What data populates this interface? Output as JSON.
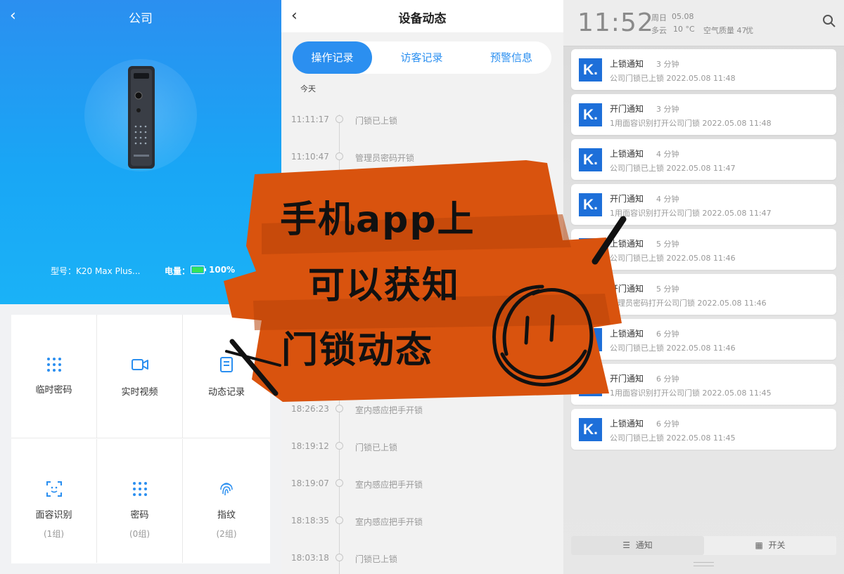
{
  "panel_home": {
    "title": "公司",
    "model_label": "型号：K20 Max Plus...",
    "battery_label": "电量：",
    "battery_value": "100%",
    "features": [
      {
        "label": "临时密码",
        "sub": "",
        "icon": "keypad-icon"
      },
      {
        "label": "实时视频",
        "sub": "",
        "icon": "video-camera-icon"
      },
      {
        "label": "动态记录",
        "sub": "",
        "icon": "document-list-icon"
      },
      {
        "label": "面容识别",
        "sub": "(1组)",
        "icon": "face-scan-icon"
      },
      {
        "label": "密码",
        "sub": "(0组)",
        "icon": "keypad-icon"
      },
      {
        "label": "指纹",
        "sub": "(2组)",
        "icon": "fingerprint-icon"
      }
    ],
    "colors": {
      "hero_top": "#2b8ff0",
      "hero_bottom": "#1ab2f7",
      "battery": "#35e25a"
    }
  },
  "panel_activity": {
    "title": "设备动态",
    "tabs": [
      {
        "label": "操作记录",
        "active": true
      },
      {
        "label": "访客记录",
        "active": false
      },
      {
        "label": "预警信息",
        "active": false
      }
    ],
    "section_label": "今天",
    "records": [
      {
        "time": "11:11:17",
        "event": "门锁已上锁"
      },
      {
        "time": "11:10:47",
        "event": "管理员密码开锁"
      },
      {
        "time": "18:26:23",
        "event": "室内感应把手开锁"
      },
      {
        "time": "18:19:12",
        "event": "门锁已上锁"
      },
      {
        "time": "18:19:07",
        "event": "室内感应把手开锁"
      },
      {
        "time": "18:18:35",
        "event": "室内感应把手开锁"
      },
      {
        "time": "18:03:18",
        "event": "门锁已上锁"
      }
    ],
    "accent": "#2b8ff0"
  },
  "panel_notifications": {
    "clock": "11:52",
    "weekday": "周日",
    "date": "05.08",
    "weather": "多云",
    "temp": "10 °C",
    "air_quality": "空气质量 47",
    "air_level": "优",
    "app_logo": "K.",
    "notifications": [
      {
        "title": "上锁通知",
        "ago": "3 分钟",
        "body": "公司门锁已上锁   2022.05.08 11:48"
      },
      {
        "title": "开门通知",
        "ago": "3 分钟",
        "body": "1用面容识别打开公司门锁 2022.05.08 11:48"
      },
      {
        "title": "上锁通知",
        "ago": "4 分钟",
        "body": "公司门锁已上锁   2022.05.08 11:47"
      },
      {
        "title": "开门通知",
        "ago": "4 分钟",
        "body": "1用面容识别打开公司门锁 2022.05.08 11:47"
      },
      {
        "title": "上锁通知",
        "ago": "5 分钟",
        "body": "公司门锁已上锁   2022.05.08 11:46"
      },
      {
        "title": "开门通知",
        "ago": "5 分钟",
        "body": "管理员密码打开公司门锁 2022.05.08 11:46"
      },
      {
        "title": "上锁通知",
        "ago": "6 分钟",
        "body": "公司门锁已上锁   2022.05.08 11:46"
      },
      {
        "title": "开门通知",
        "ago": "6 分钟",
        "body": "1用面容识别打开公司门锁 2022.05.08 11:45"
      },
      {
        "title": "上锁通知",
        "ago": "6 分钟",
        "body": "公司门锁已上锁   2022.05.08 11:45"
      }
    ],
    "bottom_tabs": [
      {
        "label": "通知",
        "icon": "list-icon",
        "selected": true
      },
      {
        "label": "开关",
        "icon": "grid-icon",
        "selected": false
      }
    ],
    "logo_color": "#1d6fd9"
  },
  "overlay": {
    "lines": [
      "手机app上",
      "可以获知",
      "门锁动态"
    ],
    "tape_color": "#d9530e",
    "doodle": "smiley-doodle"
  }
}
